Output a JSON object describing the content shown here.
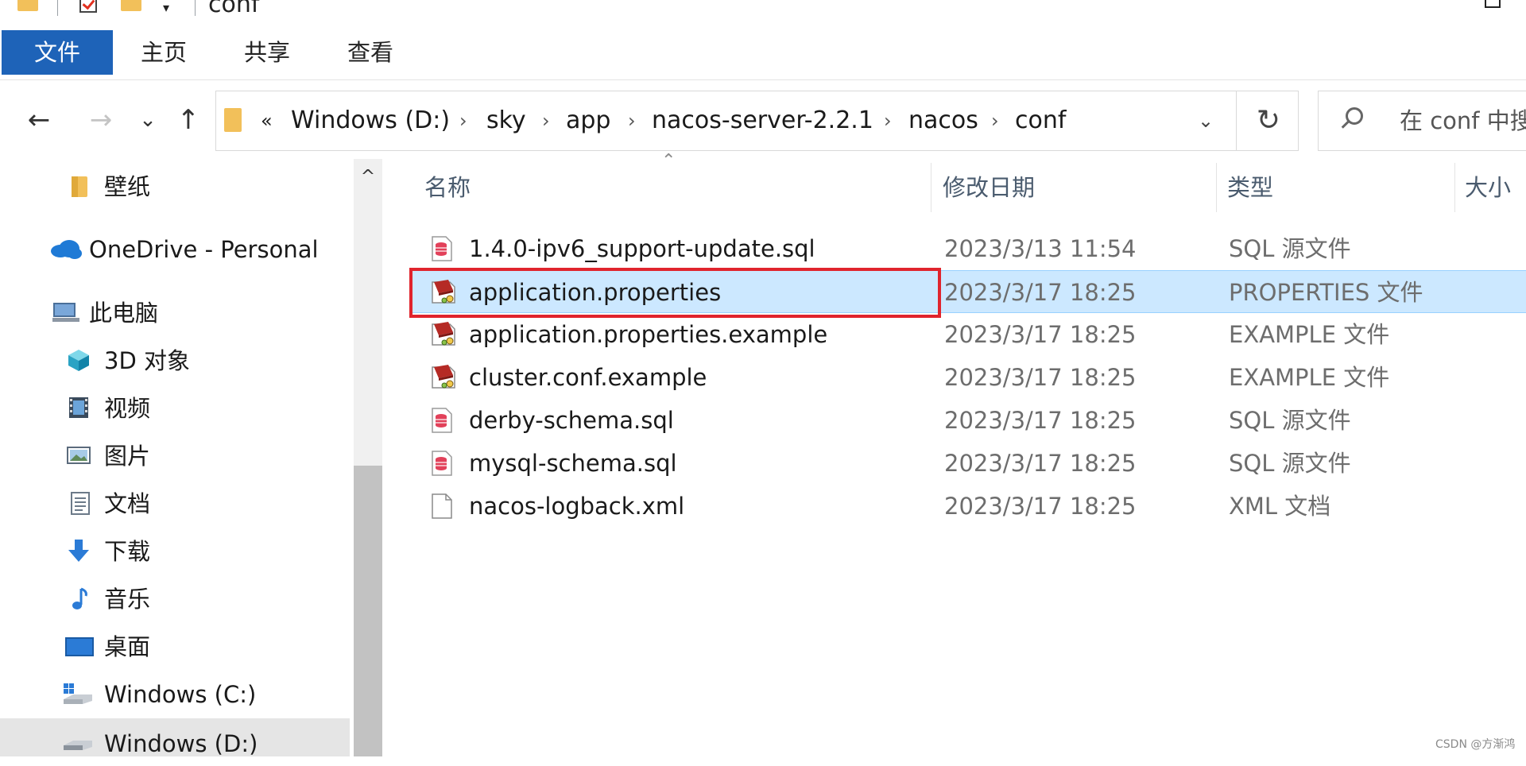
{
  "title": "conf",
  "ribbon": {
    "tabs": [
      {
        "label": "文件",
        "active": true
      },
      {
        "label": "主页",
        "active": false
      },
      {
        "label": "共享",
        "active": false
      },
      {
        "label": "查看",
        "active": false
      }
    ]
  },
  "nav": {
    "back": "←",
    "forward": "→",
    "recent": "⌄",
    "up": "↑"
  },
  "address": {
    "overflow": "«",
    "crumbs": [
      "Windows (D:)",
      "sky",
      "app",
      "nacos-server-2.2.1",
      "nacos",
      "conf"
    ],
    "separator": "›",
    "dropdown": "⌄",
    "refresh": "↻"
  },
  "search": {
    "placeholder": "在 conf 中搜"
  },
  "sidebar": {
    "scroll_up": "^",
    "items": [
      {
        "label": "壁纸",
        "icon": "folder-icon"
      },
      {
        "label": "OneDrive - Personal",
        "icon": "onedrive-icon"
      },
      {
        "label": "此电脑",
        "icon": "computer-icon"
      },
      {
        "label": "3D 对象",
        "icon": "3d-objects-icon"
      },
      {
        "label": "视频",
        "icon": "video-icon"
      },
      {
        "label": "图片",
        "icon": "pictures-icon"
      },
      {
        "label": "文档",
        "icon": "documents-icon"
      },
      {
        "label": "下载",
        "icon": "download-icon"
      },
      {
        "label": "音乐",
        "icon": "music-icon"
      },
      {
        "label": "桌面",
        "icon": "desktop-icon"
      },
      {
        "label": "Windows (C:)",
        "icon": "drive-c-icon"
      },
      {
        "label": "Windows (D:)",
        "icon": "drive-d-icon"
      }
    ]
  },
  "columns": {
    "name": "名称",
    "date": "修改日期",
    "type": "类型",
    "size": "大小"
  },
  "files": [
    {
      "name": "1.4.0-ipv6_support-update.sql",
      "date": "2023/3/13 11:54",
      "type": "SQL 源文件",
      "icon": "sql-file-icon"
    },
    {
      "name": "application.properties",
      "date": "2023/3/17 18:25",
      "type": "PROPERTIES 文件",
      "icon": "properties-file-icon"
    },
    {
      "name": "application.properties.example",
      "date": "2023/3/17 18:25",
      "type": "EXAMPLE 文件",
      "icon": "example-file-icon"
    },
    {
      "name": "cluster.conf.example",
      "date": "2023/3/17 18:25",
      "type": "EXAMPLE 文件",
      "icon": "example-file-icon"
    },
    {
      "name": "derby-schema.sql",
      "date": "2023/3/17 18:25",
      "type": "SQL 源文件",
      "icon": "sql-file-icon"
    },
    {
      "name": "mysql-schema.sql",
      "date": "2023/3/17 18:25",
      "type": "SQL 源文件",
      "icon": "sql-file-icon"
    },
    {
      "name": "nacos-logback.xml",
      "date": "2023/3/17 18:25",
      "type": "XML 文档",
      "icon": "xml-file-icon"
    }
  ],
  "selected_file": "application.properties",
  "watermark": "CSDN @方渐鸿",
  "colors": {
    "ribbon_active": "#1e63b8",
    "selection": "#cce8ff",
    "highlight_box": "#e0242d"
  }
}
